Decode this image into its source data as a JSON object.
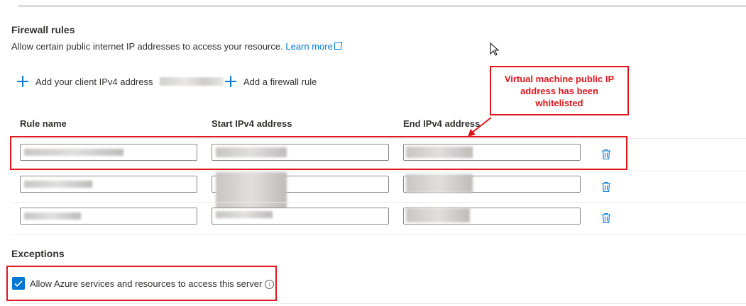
{
  "firewall": {
    "title": "Firewall rules",
    "description": "Allow certain public internet IP addresses to access your resource.",
    "learn_more": "Learn more",
    "add_client_label": "Add your client IPv4 address",
    "add_rule_label": "Add a firewall rule",
    "columns": [
      "Rule name",
      "Start IPv4 address",
      "End IPv4 address"
    ],
    "icons": {
      "add": "plus-icon",
      "delete": "trash-icon",
      "external": "external-link-icon"
    },
    "accent_color": "#0078d4"
  },
  "annotation": {
    "text": "Virtual machine public IP address has been whitelisted",
    "color": "#e0161c"
  },
  "exceptions": {
    "title": "Exceptions",
    "allow_azure_label": "Allow Azure services and resources to access this server",
    "allow_azure_checked": true
  }
}
